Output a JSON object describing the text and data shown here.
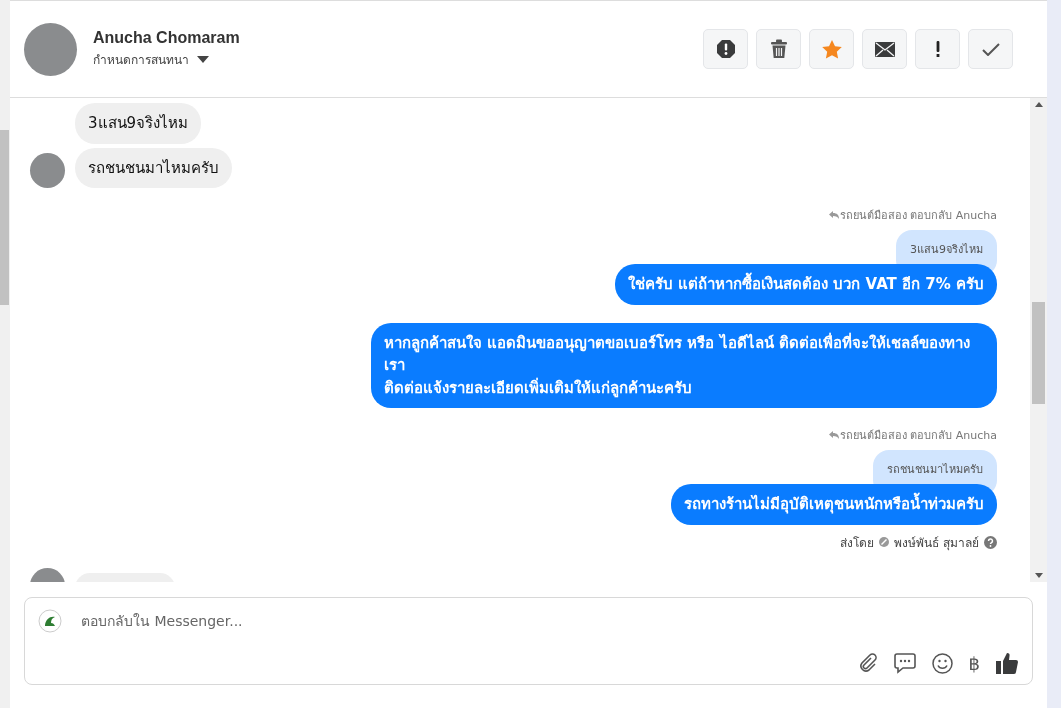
{
  "header": {
    "name": "Anucha Chomaram",
    "subtitle": "กำหนดการสนทนา",
    "actions": [
      {
        "kind": "report",
        "on": false
      },
      {
        "kind": "delete",
        "on": false
      },
      {
        "kind": "star",
        "on": true
      },
      {
        "kind": "mail",
        "on": false
      },
      {
        "kind": "important",
        "on": false
      },
      {
        "kind": "done",
        "on": false
      }
    ]
  },
  "messages": [
    {
      "kind": "incoming",
      "avatar": false,
      "text": "3แสน9จริงไหม"
    },
    {
      "kind": "incoming",
      "avatar": true,
      "text": "รถชนชนมาไหมครับ"
    },
    {
      "kind": "outgoing",
      "reply_label": "รถยนต์มือสอง ตอบกลับ Anucha",
      "quoted": "3แสน9จริงไหม",
      "text": "ใช่ครับ แต่ถ้าหากซื้อเงินสดต้อง บวก VAT อีก 7% ครับ"
    },
    {
      "kind": "outgoing",
      "text": "หากลูกค้าสนใจ แอดมินขออนุญาตขอเบอร์โทร หรือ ไอดีไลน์ ติดต่อเพื่อที่จะให้เชลล์ของทางเรา\nติดต่อแจ้งรายละเอียดเพิ่มเติมให้แก่ลูกค้านะครับ"
    },
    {
      "kind": "outgoing",
      "reply_label": "รถยนต์มือสอง ตอบกลับ Anucha",
      "quoted": "รถชนชนมาไหมครับ",
      "text": "รถทางร้านไม่มีอุบัติเหตุชนหนักหรือน้ำท่วมครับ",
      "sent_by_label": "ส่งโดย",
      "sent_by": "พงษ์พันธ์ สุมาลย์"
    }
  ],
  "composer": {
    "placeholder": "ตอบกลับใน Messenger...",
    "currency": "฿"
  }
}
